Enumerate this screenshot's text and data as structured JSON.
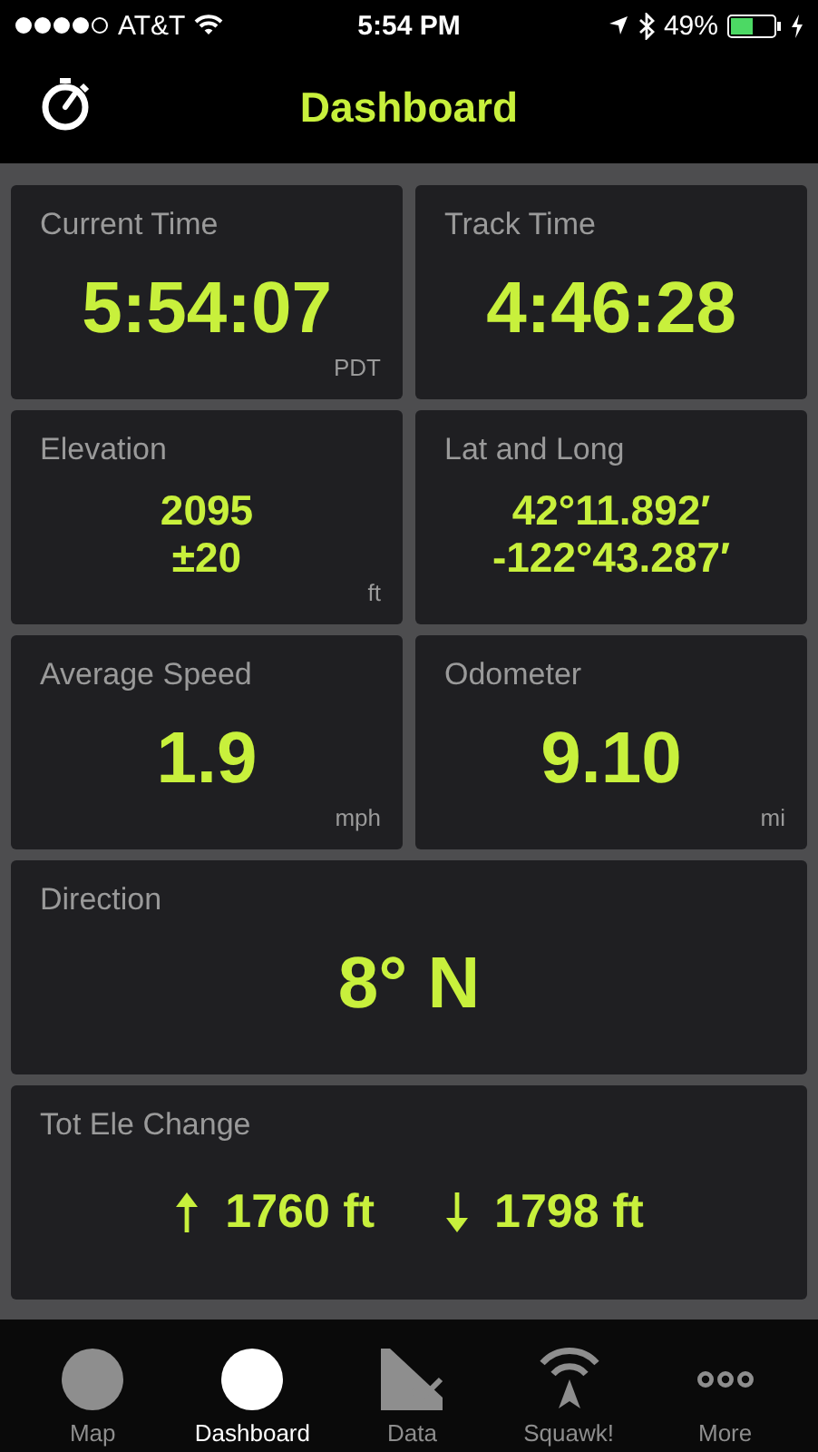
{
  "status_bar": {
    "carrier": "AT&T",
    "time": "5:54 PM",
    "battery": "49%"
  },
  "header": {
    "title": "Dashboard"
  },
  "tiles": [
    {
      "kind": "value",
      "label": "Current Time",
      "lines": [
        "5:54:07"
      ],
      "unit": "PDT"
    },
    {
      "kind": "value",
      "label": "Track Time",
      "lines": [
        "4:46:28"
      ]
    },
    {
      "kind": "value",
      "label": "Elevation",
      "lines": [
        "2095",
        "±20"
      ],
      "unit": "ft"
    },
    {
      "kind": "value",
      "label": "Lat and Long",
      "lines": [
        "42°11.892′",
        "-122°43.287′"
      ]
    },
    {
      "kind": "value",
      "label": "Average Speed",
      "lines": [
        "1.9"
      ],
      "unit": "mph"
    },
    {
      "kind": "value",
      "label": "Odometer",
      "lines": [
        "9.10"
      ],
      "unit": "mi"
    }
  ],
  "wide_tiles": [
    {
      "kind": "value",
      "label": "Direction",
      "lines": [
        "8° N"
      ]
    },
    {
      "kind": "updown",
      "label": "Tot Ele Change",
      "items": [
        {
          "kind": "up",
          "value": "1760 ft"
        },
        {
          "kind": "down",
          "value": "1798 ft"
        }
      ]
    }
  ],
  "tabs": [
    {
      "kind": "circle",
      "label": "Map",
      "selected": false
    },
    {
      "kind": "circle",
      "label": "Dashboard",
      "selected": true
    },
    {
      "kind": "chart",
      "label": "Data",
      "selected": false
    },
    {
      "kind": "antenna",
      "label": "Squawk!",
      "selected": false
    },
    {
      "kind": "dots",
      "label": "More",
      "selected": false
    }
  ]
}
